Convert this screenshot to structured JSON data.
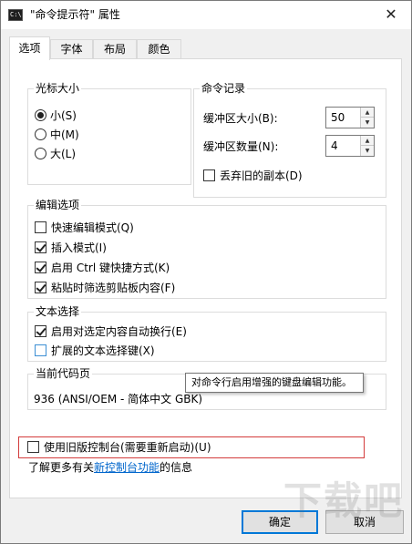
{
  "window": {
    "title": "\"命令提示符\" 属性",
    "close_glyph": "✕"
  },
  "tabs": [
    {
      "label": "选项",
      "active": true
    },
    {
      "label": "字体",
      "active": false
    },
    {
      "label": "布局",
      "active": false
    },
    {
      "label": "颜色",
      "active": false
    }
  ],
  "cursor_size": {
    "label": "光标大小",
    "options": [
      {
        "label": "小(S)",
        "checked": true
      },
      {
        "label": "中(M)",
        "checked": false
      },
      {
        "label": "大(L)",
        "checked": false
      }
    ]
  },
  "command_history": {
    "label": "命令记录",
    "buffer_size_label": "缓冲区大小(B):",
    "buffer_size_value": "50",
    "buffer_count_label": "缓冲区数量(N):",
    "buffer_count_value": "4",
    "discard_duplicates_label": "丢弃旧的副本(D)",
    "discard_duplicates_checked": false
  },
  "edit_options": {
    "label": "编辑选项",
    "items": [
      {
        "label": "快速编辑模式(Q)",
        "checked": false
      },
      {
        "label": "插入模式(I)",
        "checked": true
      },
      {
        "label": "启用 Ctrl 键快捷方式(K)",
        "checked": true
      },
      {
        "label": "粘贴时筛选剪贴板内容(F)",
        "checked": true
      }
    ]
  },
  "text_selection": {
    "label": "文本选择",
    "items": [
      {
        "label": "启用对选定内容自动换行(E)",
        "checked": true
      },
      {
        "label": "扩展的文本选择键(X)",
        "checked": false
      }
    ]
  },
  "codepage": {
    "label": "当前代码页",
    "value": "936   (ANSI/OEM - 简体中文 GBK)"
  },
  "tooltip": "对命令行启用增强的键盘编辑功能。",
  "legacy": {
    "label": "使用旧版控制台(需要重新启动)(U)",
    "checked": false,
    "highlight_color": "#d33b3b"
  },
  "learn_more": {
    "prefix": "了解更多有关",
    "link": "新控制台功能",
    "suffix": "的信息"
  },
  "buttons": {
    "ok": "确定",
    "cancel": "取消"
  },
  "watermark": "下载吧",
  "colors": {
    "accent": "#0078d7",
    "link": "#0066cc"
  }
}
